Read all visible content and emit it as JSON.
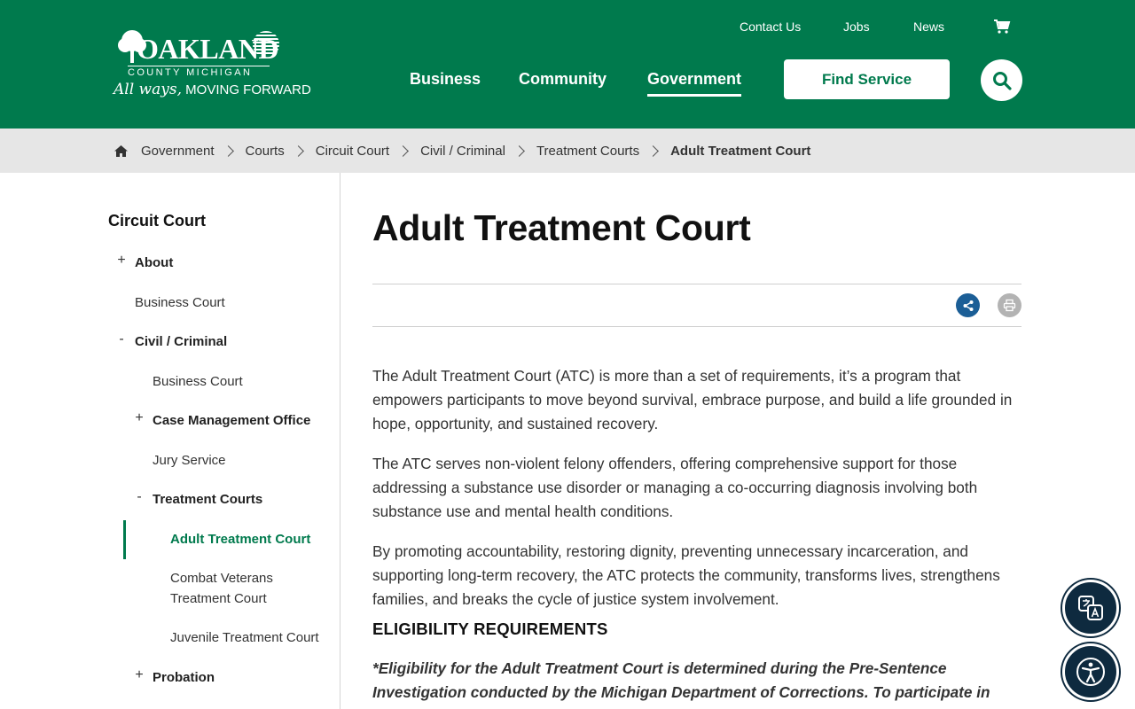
{
  "header": {
    "logo": {
      "wordmark": "OAKLAND",
      "county": "COUNTY MICHIGAN",
      "tagline_script": "All ways,",
      "tagline": "MOVING FORWARD"
    },
    "utility_links": [
      "Contact Us",
      "Jobs",
      "News"
    ],
    "main_nav": [
      "Business",
      "Community",
      "Government"
    ],
    "active_nav": "Government",
    "find_service_label": "Find Service",
    "brand_color": "#007a4d"
  },
  "breadcrumb": {
    "items": [
      "Government",
      "Courts",
      "Circuit Court",
      "Civil / Criminal",
      "Treatment Courts"
    ],
    "current": "Adult Treatment Court"
  },
  "sidebar": {
    "title": "Circuit Court",
    "items": [
      {
        "label": "About",
        "toggle": "+"
      },
      {
        "label": "Business Court"
      },
      {
        "label": "Civil / Criminal",
        "toggle": "-"
      },
      {
        "label": "Business Court"
      },
      {
        "label": "Case Management Office",
        "toggle": "+"
      },
      {
        "label": "Jury Service"
      },
      {
        "label": "Treatment Courts",
        "toggle": "-"
      },
      {
        "label": "Adult Treatment Court",
        "active": true
      },
      {
        "label": "Combat Veterans Treatment Court"
      },
      {
        "label": "Juvenile Treatment Court"
      },
      {
        "label": "Probation",
        "toggle": "+"
      }
    ]
  },
  "content": {
    "title": "Adult Treatment Court",
    "paragraphs": [
      "The Adult Treatment Court (ATC) is more than a set of requirements, it’s a program that empowers participants to move beyond survival, embrace purpose, and build a life grounded in hope, opportunity, and sustained recovery.",
      "The ATC serves non-violent felony offenders, offering comprehensive support for those addressing a substance use disorder or managing a co-occurring diagnosis involving both substance use and mental health conditions.",
      "By promoting accountability, restoring dignity, preventing unnecessary incarceration, and supporting long-term recovery, the ATC protects the community, transforms lives, strengthens families, and breaks the cycle of justice system involvement."
    ],
    "section_heading": "ELIGIBILITY REQUIREMENTS",
    "note": "*Eligibility for the Adult Treatment Court is determined during the Pre-Sentence Investigation conducted by the Michigan Department of Corrections. To participate in"
  },
  "icons": {
    "cart": "cart-icon",
    "search": "search-icon",
    "home": "home-icon",
    "share": "share-icon",
    "print": "print-icon",
    "translate": "translate-icon",
    "accessibility": "accessibility-icon"
  }
}
